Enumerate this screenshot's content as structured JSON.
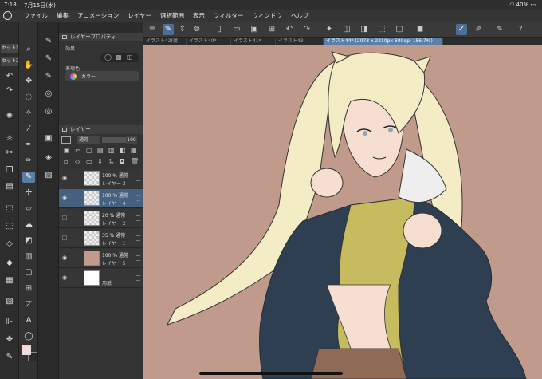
{
  "status": {
    "time": "7:18",
    "date": "7月15日(水)",
    "battery": "40%"
  },
  "menu": [
    "ファイル",
    "編集",
    "アニメーション",
    "レイヤー",
    "選択範囲",
    "表示",
    "フィルター",
    "ウィンドウ",
    "ヘルプ"
  ],
  "tabs": [
    "イラスト42(復",
    "イラスト40*",
    "イラスト41*",
    "イラスト43",
    "イラスト44* (2073 x 2210px 600dpi 156.7%)"
  ],
  "sets": [
    "セット1",
    "セット2"
  ],
  "property": {
    "title": "レイヤープロパティ",
    "effect_label": "効果",
    "color_label": "表現色",
    "color_value": "カラー"
  },
  "layers_panel": {
    "title": "レイヤー",
    "blend": "通常",
    "opacity": "100"
  },
  "layers": [
    {
      "opacity": "100 % 通常",
      "name": "レイヤー 3",
      "visible": true,
      "selected": false
    },
    {
      "opacity": "100 % 通常",
      "name": "レイヤー 4",
      "visible": true,
      "selected": true
    },
    {
      "opacity": "20 % 通常",
      "name": "レイヤー 2",
      "visible": false,
      "selected": false
    },
    {
      "opacity": "35 % 通常",
      "name": "レイヤー 1",
      "visible": false,
      "selected": false
    },
    {
      "opacity": "100 % 通常",
      "name": "レイヤー 5",
      "visible": true,
      "selected": false
    },
    {
      "opacity": "",
      "name": "用紙",
      "visible": true,
      "selected": false
    }
  ],
  "colors": {
    "canvas_bg": "#c09a8b",
    "accent": "#5b7da3",
    "fg_color": "#f4ddd4"
  }
}
